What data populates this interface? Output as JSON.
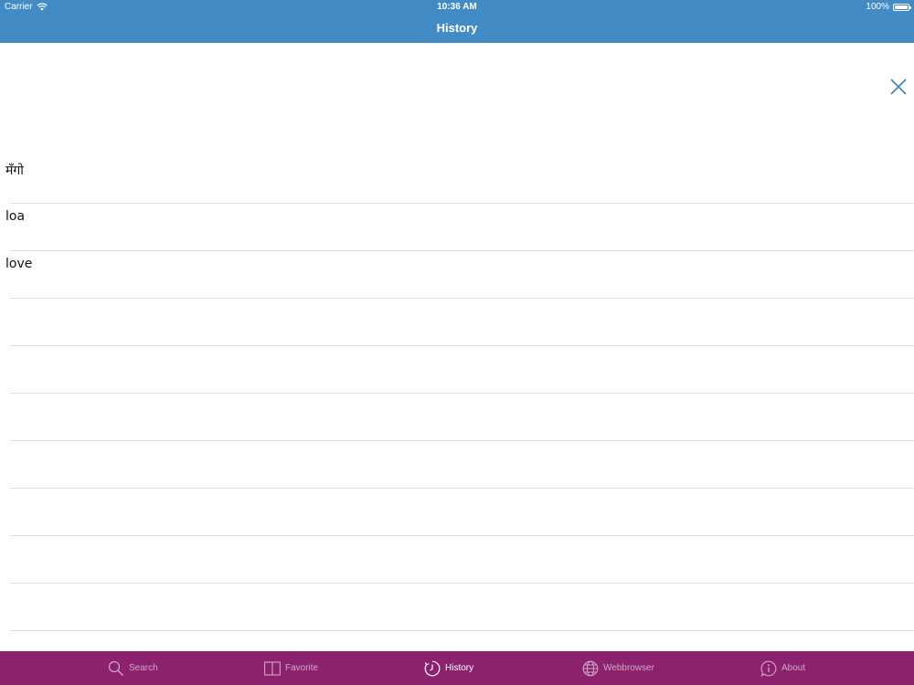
{
  "status_bar": {
    "carrier": "Carrier",
    "time": "10:36 AM",
    "battery": "100%"
  },
  "nav": {
    "title": "History"
  },
  "history": {
    "items": [
      "मँगो",
      "loa",
      "love",
      "",
      "",
      "",
      "",
      "",
      "",
      "",
      ""
    ]
  },
  "tabbar": {
    "tabs": [
      {
        "label": "Search",
        "icon": "search-icon"
      },
      {
        "label": "Favorite",
        "icon": "book-icon"
      },
      {
        "label": "History",
        "icon": "clock-icon"
      },
      {
        "label": "Webbrowser",
        "icon": "globe-icon"
      },
      {
        "label": "About",
        "icon": "info-icon"
      }
    ],
    "active": "History"
  },
  "colors": {
    "nav_bar": "#428bc5",
    "tab_bar": "#8c226e",
    "close_icon": "#3d7fb8"
  }
}
